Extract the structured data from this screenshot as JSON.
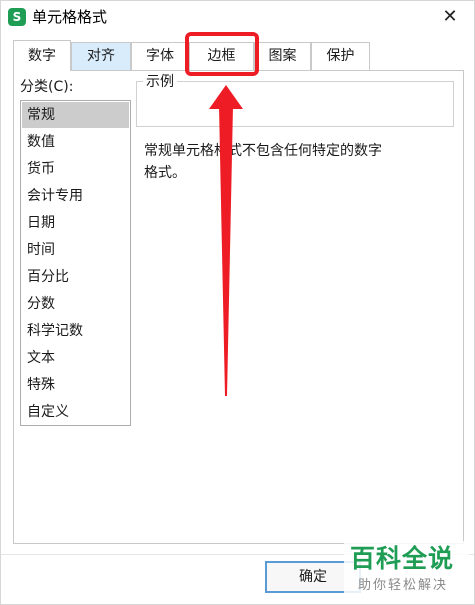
{
  "window": {
    "title": "单元格格式",
    "app_icon_letter": "S",
    "close_glyph": "✕"
  },
  "tabs": [
    {
      "label": "数字",
      "active": true
    },
    {
      "label": "对齐"
    },
    {
      "label": "字体"
    },
    {
      "label": "边框"
    },
    {
      "label": "图案"
    },
    {
      "label": "保护"
    }
  ],
  "category": {
    "label": "分类(C):",
    "items": [
      "常规",
      "数值",
      "货币",
      "会计专用",
      "日期",
      "时间",
      "百分比",
      "分数",
      "科学记数",
      "文本",
      "特殊",
      "自定义"
    ],
    "selected": "常规"
  },
  "example": {
    "legend": "示例",
    "value": ""
  },
  "description": {
    "line1": "常规单元格格式不包含任何特定的数字",
    "line2": "格式。"
  },
  "buttons": {
    "ok": "确定"
  },
  "annotation": {
    "highlight_color": "#ee1c25"
  },
  "watermark": {
    "main": "百科全说",
    "sub": "助你轻松解决"
  },
  "colors": {
    "brand_green": "#1f9d55",
    "selection_gray": "#cccccc",
    "tab_hover": "#d9ecfb",
    "focus_blue": "#5b9bd5"
  }
}
